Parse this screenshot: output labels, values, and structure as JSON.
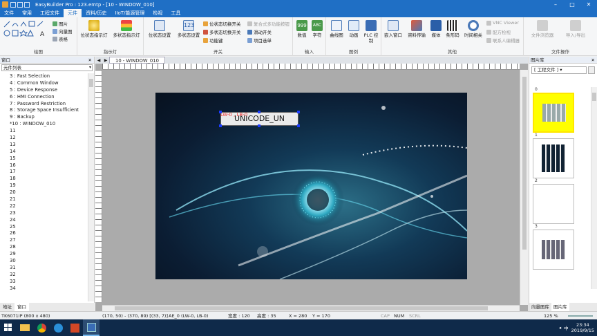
{
  "window": {
    "title": "EasyBuilder Pro : 123.emtp - [10 - WINDOW_010]",
    "controls": [
      "–",
      "□",
      "✕"
    ]
  },
  "menu": {
    "items": [
      "文件",
      "常用",
      "工程文件",
      "元件",
      "资料/历史",
      "IIoT/能源管理",
      "检视",
      "工具"
    ],
    "active_index": 3
  },
  "ribbon": {
    "groups": {
      "draw": {
        "label": "绘图",
        "small": [
          "图片",
          "向量图",
          "表格"
        ]
      },
      "indicator": {
        "label": "指示灯",
        "buttons": [
          "位状态指示灯",
          "多状态指示灯"
        ]
      },
      "switch": {
        "label": "开关",
        "buttons": [
          "位状态设置",
          "多状态设置"
        ],
        "small": [
          "位状态切换开关",
          "多状态切换开关",
          "功能键",
          "复合式多功能按钮",
          "滑动开关",
          "项目选单"
        ]
      },
      "input": {
        "label": "输入",
        "buttons": [
          "数值",
          "字符"
        ]
      },
      "chart": {
        "label": "图例",
        "buttons": [
          "曲线图",
          "动画",
          "PLC 控制"
        ]
      },
      "other": {
        "label": "其他",
        "buttons": [
          "嵌入窗口",
          "资料传输",
          "媒体",
          "条形码",
          "时间相关"
        ],
        "small": [
          "VNC Viewer",
          "配方检视",
          "联系人编辑器"
        ]
      },
      "file_ops": {
        "label": "文件操作",
        "buttons": [
          "文件浏览器",
          "导入/导出"
        ]
      }
    }
  },
  "left_panel": {
    "header": "窗口",
    "combo": "元件列表",
    "tree": [
      "3 : Fast Selection",
      "4 : Common Window",
      "5 : Device Response",
      "6 : HMI Connection",
      "7 : Password Restriction",
      "8 : Storage Space Insufficient",
      "9 : Backup",
      "*10 : WINDOW_010",
      "11",
      "12",
      "13",
      "14",
      "15",
      "16",
      "17",
      "18",
      "19",
      "20",
      "21",
      "22",
      "23",
      "24",
      "25",
      "26",
      "27",
      "28",
      "29",
      "30",
      "31",
      "32",
      "33",
      "34"
    ],
    "tabs": [
      "地址",
      "窗口"
    ],
    "active_tab": 1
  },
  "editor": {
    "tab_label": "10 - WINDOW_010",
    "object_text": "UNICODE_UN",
    "object_tag": "LW-0 , LB-0"
  },
  "right_panel": {
    "header": "图片库",
    "combo": "[ 工程文件 ]",
    "thumbnails": [
      "0",
      "1",
      "2",
      "3"
    ],
    "selected": 0,
    "tabs": [
      "向量图库",
      "图片库"
    ],
    "active_tab": 1
  },
  "status": {
    "model": "TK6071iP (800 x 480)",
    "coords": "(170, 50) - (370, 89) [(33, 7)]",
    "object": "AE_0 (LW-0, LB-0)",
    "width": "宽度 : 120",
    "height": "高度 : 35",
    "x": "X = 280",
    "y": "Y = 170",
    "cap": "CAP",
    "num": "NUM",
    "scrl": "SCRL",
    "zoom": "125 %"
  },
  "taskbar": {
    "time": "23:34",
    "date": "2019/9/15",
    "lang": "中"
  }
}
